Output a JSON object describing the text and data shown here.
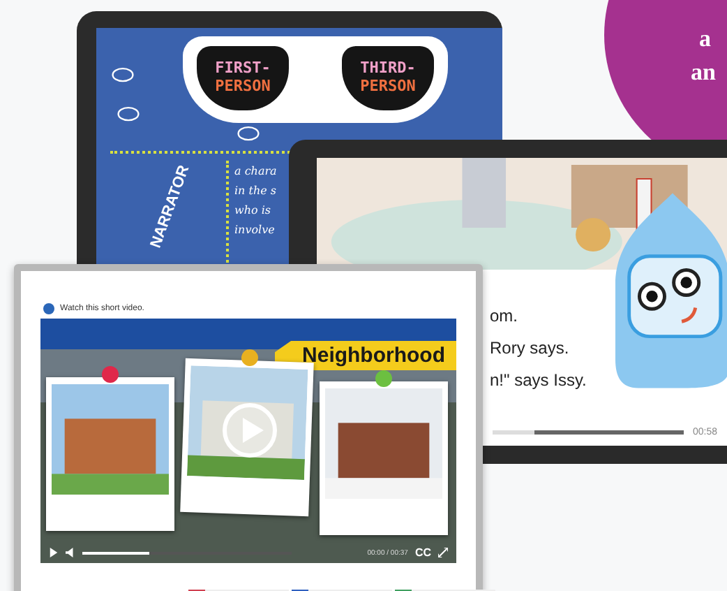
{
  "poster_tablet": {
    "lenses": [
      {
        "line_1": "FIRST-",
        "line_2": "PERSON"
      },
      {
        "line_1": "THIRD-",
        "line_2": "PERSON"
      }
    ],
    "heading": "NARRATOR",
    "definition_lines": [
      "a chara",
      "in the s",
      "who is",
      "involve"
    ]
  },
  "story_tablet": {
    "text_lines": [
      "om.",
      "Rory says.",
      "n!\" says Issy."
    ],
    "player": {
      "level": 0.22,
      "time": "00:58"
    }
  },
  "video_board": {
    "instruction": "Watch this short video.",
    "banner": "Neighborhood",
    "photos": [
      {
        "color": "#e0284a",
        "kind": "houses"
      },
      {
        "color": "#e8b020",
        "kind": "village"
      },
      {
        "color": "#6cc040",
        "kind": "street"
      }
    ],
    "player": {
      "level": 0.32,
      "time": "00:00 / 00:37",
      "captions": "CC"
    }
  },
  "badge": {
    "lines": [
      "a",
      "an"
    ]
  }
}
